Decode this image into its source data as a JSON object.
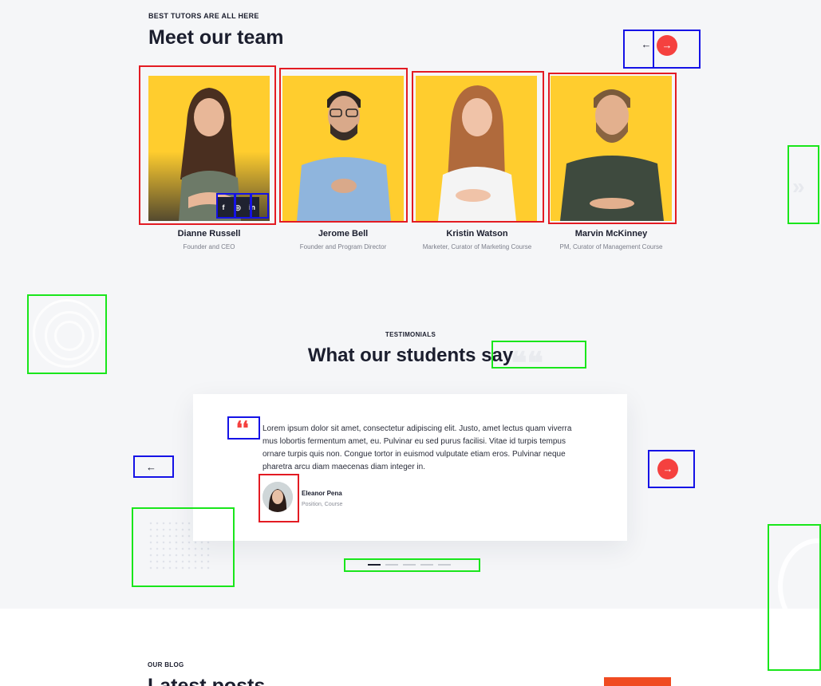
{
  "team": {
    "eyebrow": "BEST TUTORS ARE ALL HERE",
    "title": "Meet our team",
    "nav_prev": "←",
    "nav_next": "→",
    "members": [
      {
        "name": "Dianne Russell",
        "role": "Founder and CEO"
      },
      {
        "name": "Jerome Bell",
        "role": "Founder and Program Director"
      },
      {
        "name": "Kristin Watson",
        "role": "Marketer, Curator of Marketing Course"
      },
      {
        "name": "Marvin McKinney",
        "role": "PM, Curator of Management Course"
      }
    ],
    "social": [
      "f",
      "◎",
      "in"
    ]
  },
  "testimonials": {
    "eyebrow": "TESTIMONIALS",
    "title": "What our students say",
    "quote_mark": "❛❛",
    "quote": "Lorem ipsum dolor sit amet, consectetur adipiscing elit. Justo, amet lectus quam viverra mus lobortis fermentum amet, eu. Pulvinar eu sed purus facilisi. Vitae id turpis tempus ornare turpis quis non. Congue tortor in euismod vulputate etiam eros. Pulvinar neque pharetra arcu diam maecenas diam integer in.",
    "author_name": "Eleanor Pena",
    "author_role": "Position, Course",
    "prev": "←",
    "next": "→",
    "dots_active_index": 0,
    "dots_count": 5
  },
  "blog": {
    "eyebrow": "OUR BLOG",
    "title": "Latest posts"
  },
  "colors": {
    "accent": "#f5413f",
    "photo_bg": "#ffcd2e",
    "annotation_red": "#e31b23",
    "annotation_blue": "#1512e6",
    "annotation_green": "#19e61b"
  }
}
